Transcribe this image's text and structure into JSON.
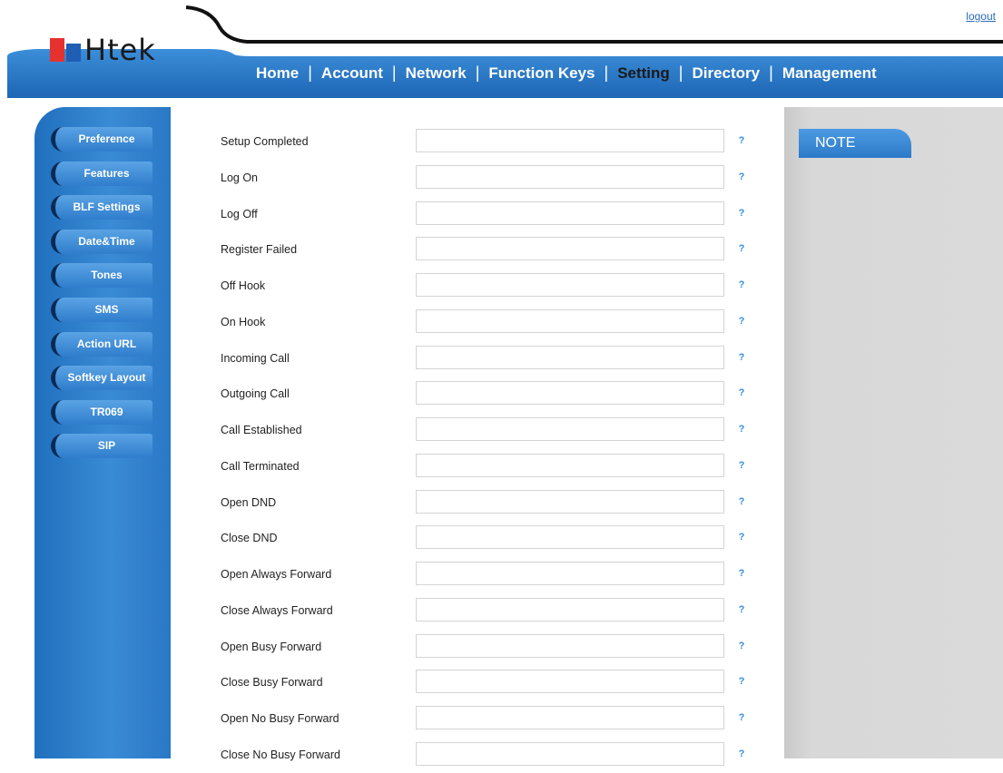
{
  "header": {
    "logout_label": "logout",
    "logo_text": "Htek",
    "nav": [
      "Home",
      "Account",
      "Network",
      "Function Keys",
      "Setting",
      "Directory",
      "Management"
    ],
    "nav_active": "Setting"
  },
  "sidebar": {
    "items": [
      "Preference",
      "Features",
      "BLF Settings",
      "Date&Time",
      "Tones",
      "SMS",
      "Action URL",
      "Softkey Layout",
      "TR069",
      "SIP"
    ],
    "active": "Action URL"
  },
  "form": {
    "help_glyph": "?",
    "rows": [
      {
        "label": "Setup Completed",
        "value": ""
      },
      {
        "label": "Log On",
        "value": ""
      },
      {
        "label": "Log Off",
        "value": ""
      },
      {
        "label": "Register Failed",
        "value": ""
      },
      {
        "label": "Off Hook",
        "value": ""
      },
      {
        "label": "On Hook",
        "value": ""
      },
      {
        "label": "Incoming Call",
        "value": ""
      },
      {
        "label": "Outgoing Call",
        "value": ""
      },
      {
        "label": "Call Established",
        "value": ""
      },
      {
        "label": "Call Terminated",
        "value": ""
      },
      {
        "label": "Open DND",
        "value": ""
      },
      {
        "label": "Close DND",
        "value": ""
      },
      {
        "label": "Open Always Forward",
        "value": ""
      },
      {
        "label": "Close Always Forward",
        "value": ""
      },
      {
        "label": "Open Busy Forward",
        "value": ""
      },
      {
        "label": "Close Busy Forward",
        "value": ""
      },
      {
        "label": "Open No Busy Forward",
        "value": ""
      },
      {
        "label": "Close No Busy Forward",
        "value": ""
      }
    ]
  },
  "note": {
    "title": "NOTE"
  },
  "colors": {
    "accent_blue": "#2f7dcc",
    "logo_red": "#e6322f",
    "logo_blue": "#1e5fb3",
    "note_panel_gray": "#d8d8d8"
  }
}
